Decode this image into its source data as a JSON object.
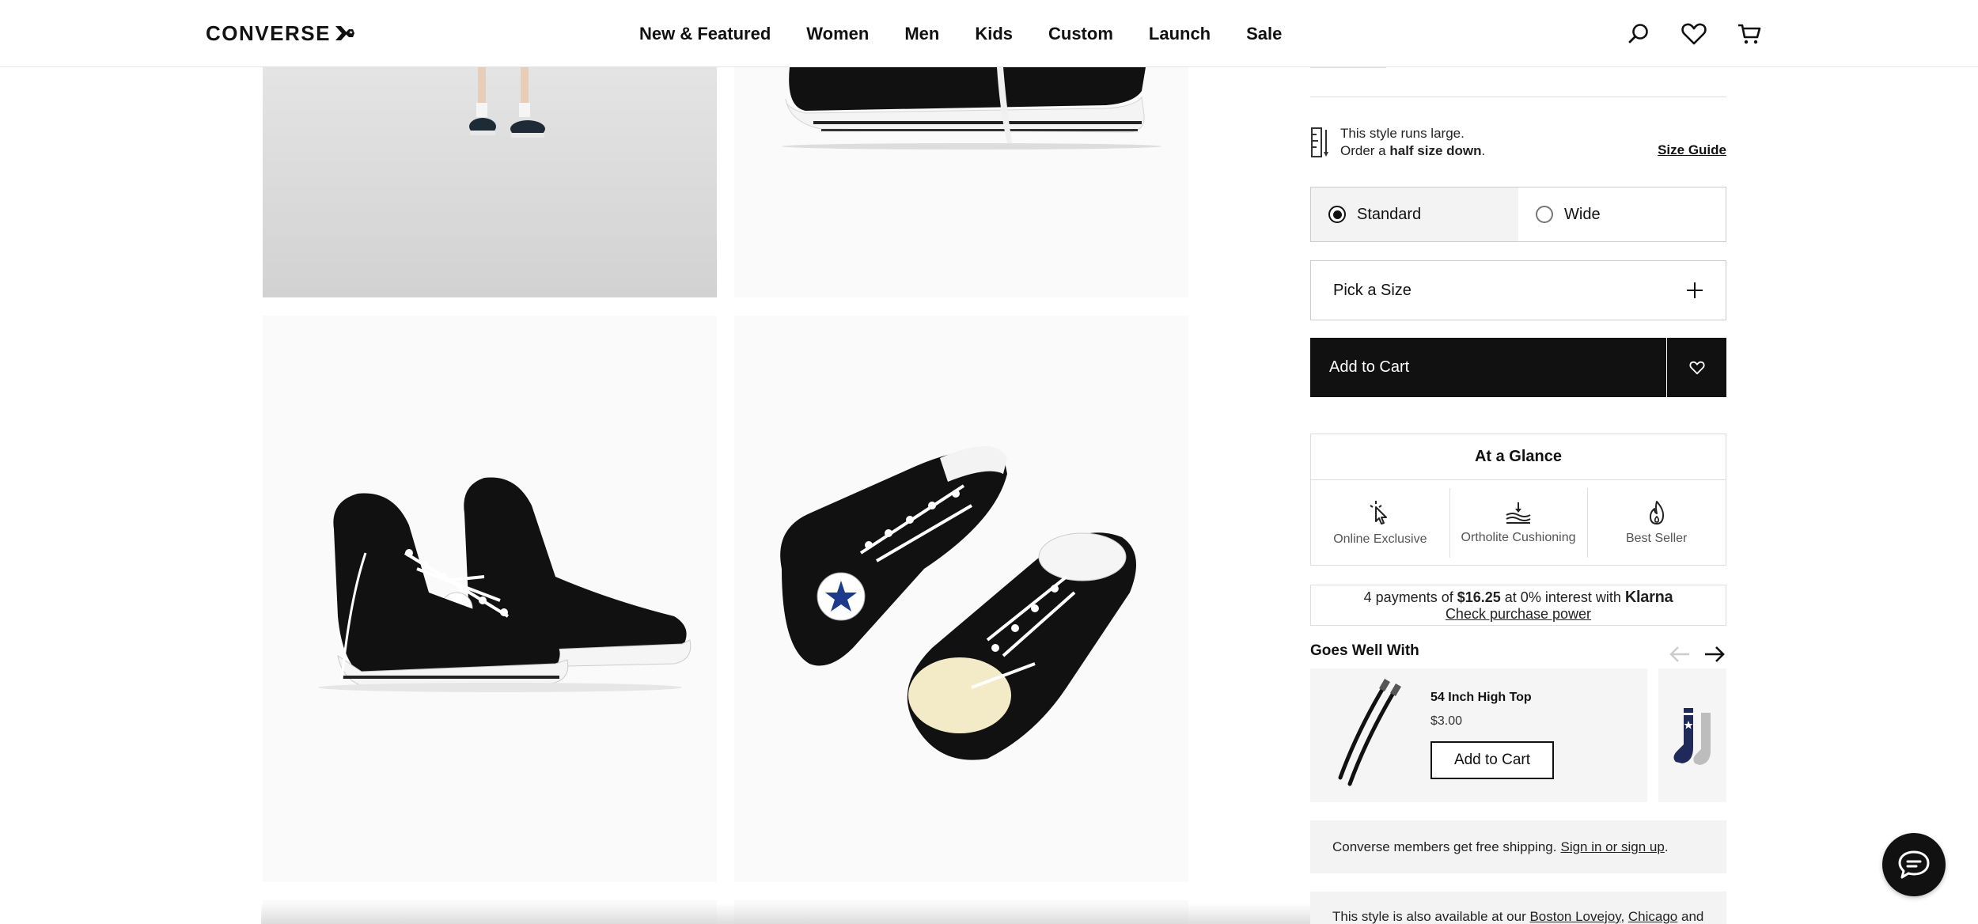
{
  "header": {
    "brand": "CONVERSE",
    "nav": [
      "New & Featured",
      "Women",
      "Men",
      "Kids",
      "Custom",
      "Launch",
      "Sale"
    ],
    "icons": [
      "search-icon",
      "heart-icon",
      "cart-icon"
    ]
  },
  "product": {
    "fit_line1": "This style runs large.",
    "fit_line2_pre": "Order a ",
    "fit_line2_bold": "half size down",
    "fit_line2_post": ".",
    "size_guide": "Size Guide",
    "widths": [
      "Standard",
      "Wide"
    ],
    "selected_width": "Standard",
    "pick_size": "Pick a Size",
    "add_to_cart": "Add to Cart"
  },
  "glance": {
    "title": "At a Glance",
    "items": [
      {
        "label": "Online Exclusive",
        "icon": "cursor-click-icon"
      },
      {
        "label": "Ortholite Cushioning",
        "icon": "cushioning-icon"
      },
      {
        "label": "Best Seller",
        "icon": "flame-icon"
      }
    ]
  },
  "klarna": {
    "pre": "4 payments of ",
    "amount": "$16.25",
    "mid": " at 0% interest with ",
    "brand": "Klarna",
    "link": "Check purchase power"
  },
  "goes_well": {
    "title": "Goes Well With",
    "items": [
      {
        "name": "54 Inch High Top",
        "price": "$3.00",
        "button": "Add to Cart"
      }
    ]
  },
  "shipping": {
    "text": "Converse members get free shipping.",
    "link": "Sign in or sign up",
    "post": "."
  },
  "availability": {
    "pre": "This style is also available at our ",
    "link1": "Boston Lovejoy",
    "sep": ", ",
    "link2": "Chicago",
    "post": " and"
  },
  "colors": {
    "black": "#111111",
    "panel": "#f3f3f3",
    "border": "#dddddd"
  }
}
